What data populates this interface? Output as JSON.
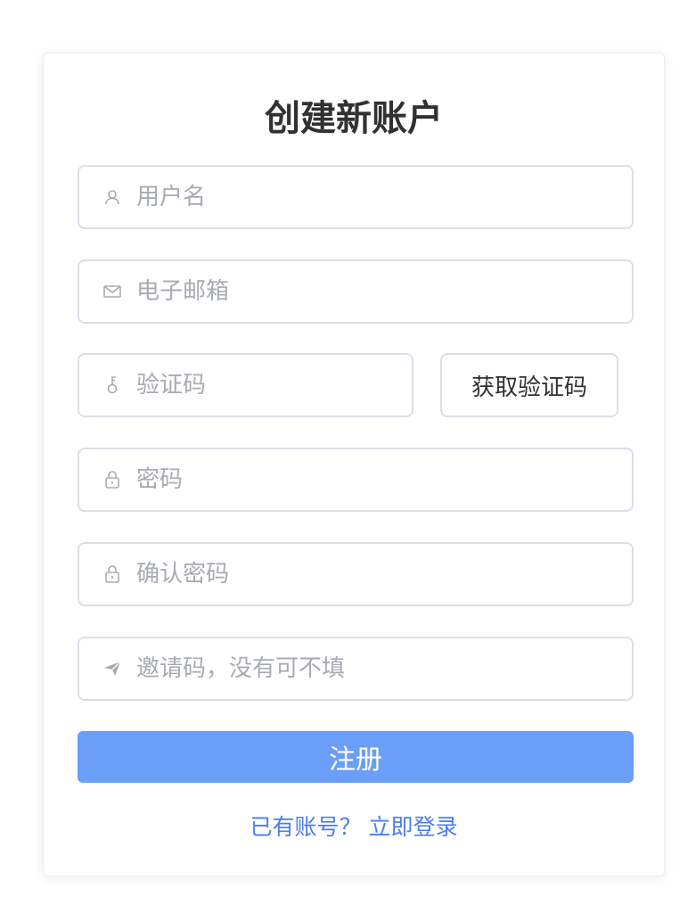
{
  "form": {
    "title": "创建新账户",
    "username": {
      "placeholder": "用户名",
      "value": "",
      "icon": "user-icon"
    },
    "email": {
      "placeholder": "电子邮箱",
      "value": "",
      "icon": "mail-icon"
    },
    "code": {
      "placeholder": "验证码",
      "value": "",
      "icon": "key-icon"
    },
    "get_code_label": "获取验证码",
    "password": {
      "placeholder": "密码",
      "value": "",
      "icon": "lock-icon"
    },
    "confirm_password": {
      "placeholder": "确认密码",
      "value": "",
      "icon": "lock-icon"
    },
    "invite": {
      "placeholder": "邀请码，没有可不填",
      "value": "",
      "icon": "send-icon"
    },
    "submit_label": "注册",
    "login_link": "已有账号？ 立即登录"
  },
  "colors": {
    "primary": "#6b9ef8",
    "link": "#4a7ef0",
    "border": "#dcdfe6",
    "placeholder": "#a8abb2",
    "title": "#303133"
  }
}
